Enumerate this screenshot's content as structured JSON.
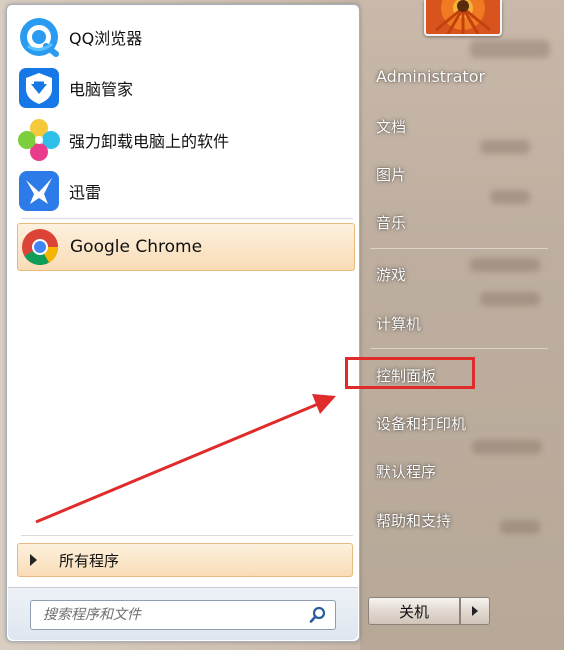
{
  "start_menu": {
    "pinned_apps": [
      {
        "label": "QQ浏览器",
        "icon": "qq-browser-icon"
      },
      {
        "label": "电脑管家",
        "icon": "pc-manager-icon"
      },
      {
        "label": "强力卸载电脑上的软件",
        "icon": "uninstall-flower-icon"
      },
      {
        "label": "迅雷",
        "icon": "xunlei-bird-icon"
      },
      {
        "label": "Google Chrome",
        "icon": "chrome-icon",
        "highlighted": true
      }
    ],
    "all_programs_label": "所有程序",
    "search": {
      "placeholder": "搜索程序和文件"
    },
    "right_items": [
      "Administrator",
      "文档",
      "图片",
      "音乐",
      "游戏",
      "计算机",
      "控制面板",
      "设备和打印机",
      "默认程序",
      "帮助和支持"
    ],
    "shutdown_label": "关机",
    "annotation": {
      "highlighted_item": "控制面板",
      "color": "#e02b2b"
    }
  }
}
